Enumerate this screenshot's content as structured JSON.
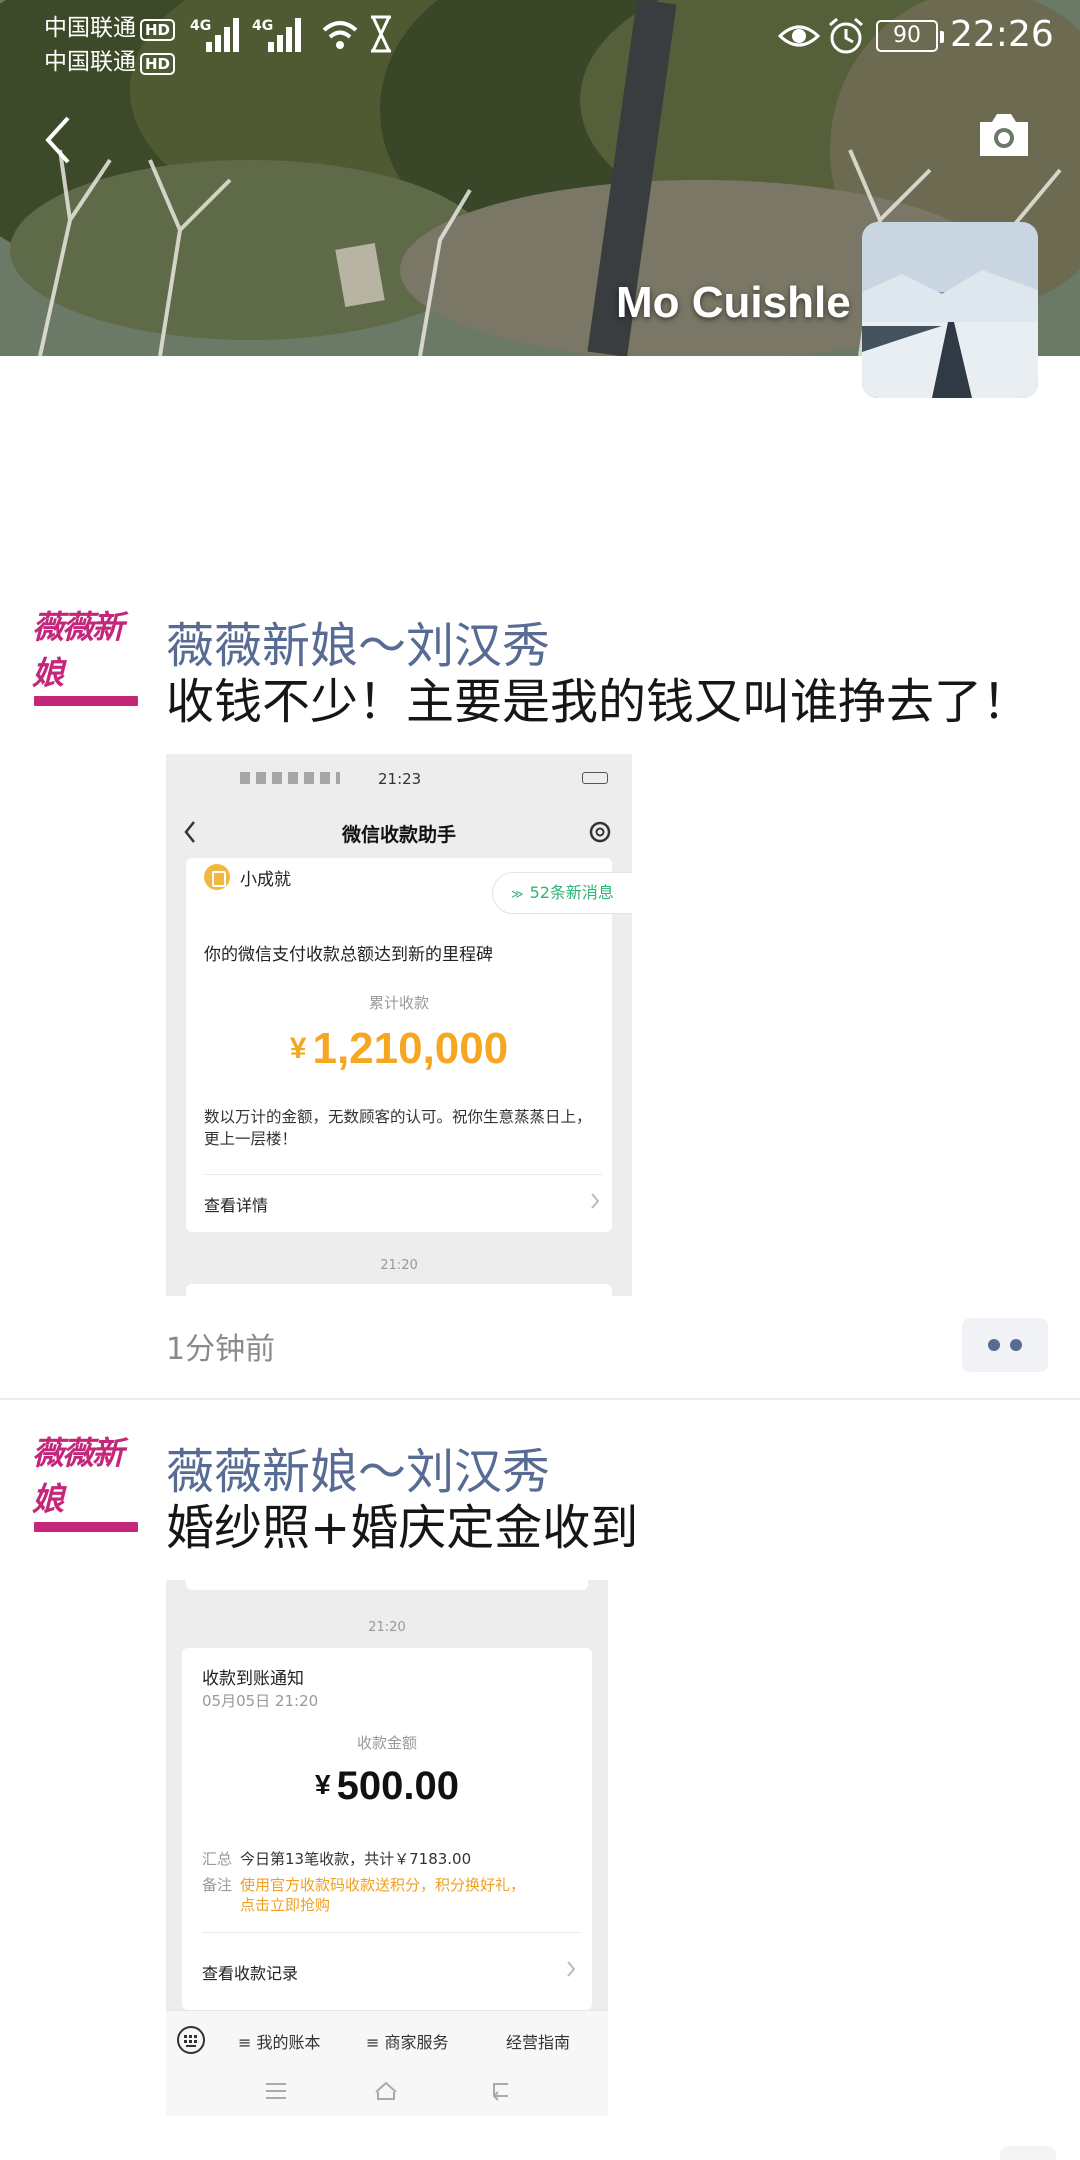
{
  "status_bar": {
    "carrier_1": "中国联通",
    "carrier_2": "中国联通",
    "hd_badge": "HD",
    "network_1": "4G",
    "network_2": "4G",
    "battery": "90",
    "time": "22:26"
  },
  "profile": {
    "name": "Mo Cuishle"
  },
  "icons": {
    "back": "chevron-left-icon",
    "camera": "camera-icon",
    "more": "more-dots-icon"
  },
  "colors": {
    "author_link": "#576b95",
    "amount_orange": "#f5a623",
    "new_msg_green": "#2bb673",
    "logo_magenta": "#c4267a"
  },
  "posts": [
    {
      "author": "薇薇新娘～刘汉秀",
      "avatar_logo": "薇薇新娘",
      "text": "收钱不少！主要是我的钱又叫谁挣去了！",
      "timestamp": "1分钟前",
      "image": {
        "status_time": "21:23",
        "nav_title": "微信收款助手",
        "achievement": "小成就",
        "new_messages": "52条新消息",
        "message": "你的微信支付收款总额达到新的里程碑",
        "cumulative_label": "累计收款",
        "currency": "¥",
        "amount": "1,210,000",
        "description": "数以万计的金额，无数顾客的认可。祝你生意蒸蒸日上，更上一层楼！",
        "details_link": "查看详情",
        "next_time": "21:20"
      }
    },
    {
      "author": "薇薇新娘～刘汉秀",
      "avatar_logo": "薇薇新娘",
      "text": "婚纱照+婚庆定金收到",
      "image": {
        "time": "21:20",
        "title": "收款到账通知",
        "date": "05月05日 21:20",
        "amount_label": "收款金额",
        "currency": "¥",
        "amount": "500.00",
        "summary_label": "汇总",
        "summary": "今日第13笔收款，共计￥7183.00",
        "note_label": "备注",
        "note_line1": "使用官方收款码收款送积分，积分换好礼，",
        "note_line2": "点击立即抢购",
        "records_link": "查看收款记录",
        "menu": [
          "≡ 我的账本",
          "≡ 商家服务",
          "经营指南"
        ]
      }
    }
  ]
}
